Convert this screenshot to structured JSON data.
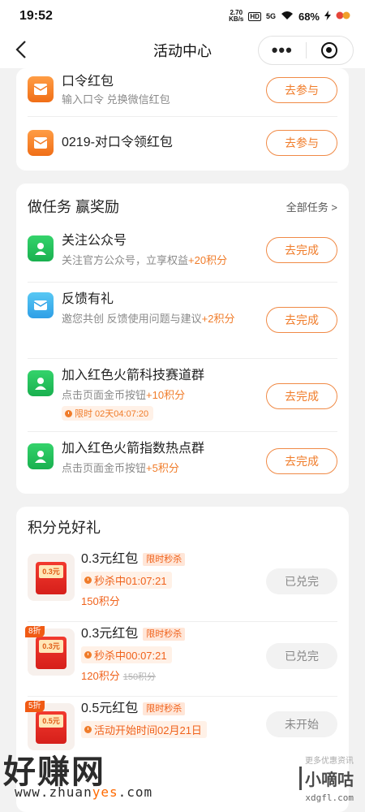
{
  "status_bar": {
    "time": "19:52",
    "net_speed_value": "2.70",
    "net_speed_unit": "KB/s",
    "hd": "HD",
    "signal": "5G",
    "battery": "68%"
  },
  "nav": {
    "title": "活动中心",
    "more": "•••"
  },
  "codes_card": {
    "items": [
      {
        "title": "口令红包",
        "desc": "输入口令 兑换微信红包",
        "button": "去参与"
      },
      {
        "title": "0219-对口令领红包",
        "button": "去参与"
      }
    ]
  },
  "tasks_card": {
    "title": "做任务 赢奖励",
    "all_tasks": "全部任务 >",
    "items": [
      {
        "title": "关注公众号",
        "desc": "关注官方公众号，立享权益",
        "points": "+20积分",
        "button": "去完成"
      },
      {
        "title": "反馈有礼",
        "desc": "邀您共创 反馈使用问题与建议",
        "points": "+2积分",
        "button": "去完成"
      },
      {
        "title": "加入红色火箭科技赛道群",
        "desc": "点击页面金币按钮",
        "points": "+10积分",
        "timer": "限时 02天04:07:20",
        "button": "去完成"
      },
      {
        "title": "加入红色火箭指数热点群",
        "desc": "点击页面金币按钮",
        "points": "+5积分",
        "button": "去完成"
      }
    ]
  },
  "redeem_card": {
    "title": "积分兑好礼",
    "items": [
      {
        "thumb_label": "0.3元",
        "title": "0.3元红包",
        "tag": "限时秒杀",
        "timer": "秒杀中01:07:21",
        "cost": "150积分",
        "button": "已兑完"
      },
      {
        "discount": "8折",
        "thumb_label": "0.3元",
        "title": "0.3元红包",
        "tag": "限时秒杀",
        "timer": "秒杀中00:07:21",
        "cost": "120积分",
        "original_cost": "150积分",
        "button": "已兑完"
      },
      {
        "discount": "5折",
        "thumb_label": "0.5元",
        "title": "0.5元红包",
        "tag": "限时秒杀",
        "timer": "活动开始时间02月21日",
        "button": "未开始"
      }
    ]
  },
  "watermark": {
    "main": "好赚网",
    "url_prefix": "www.zhuan",
    "url_highlight": "yes",
    "url_suffix": ".com",
    "right_top": "更多优惠资讯",
    "right_mid": "小嘀咕",
    "right_bottom": "xdgfl.com"
  }
}
